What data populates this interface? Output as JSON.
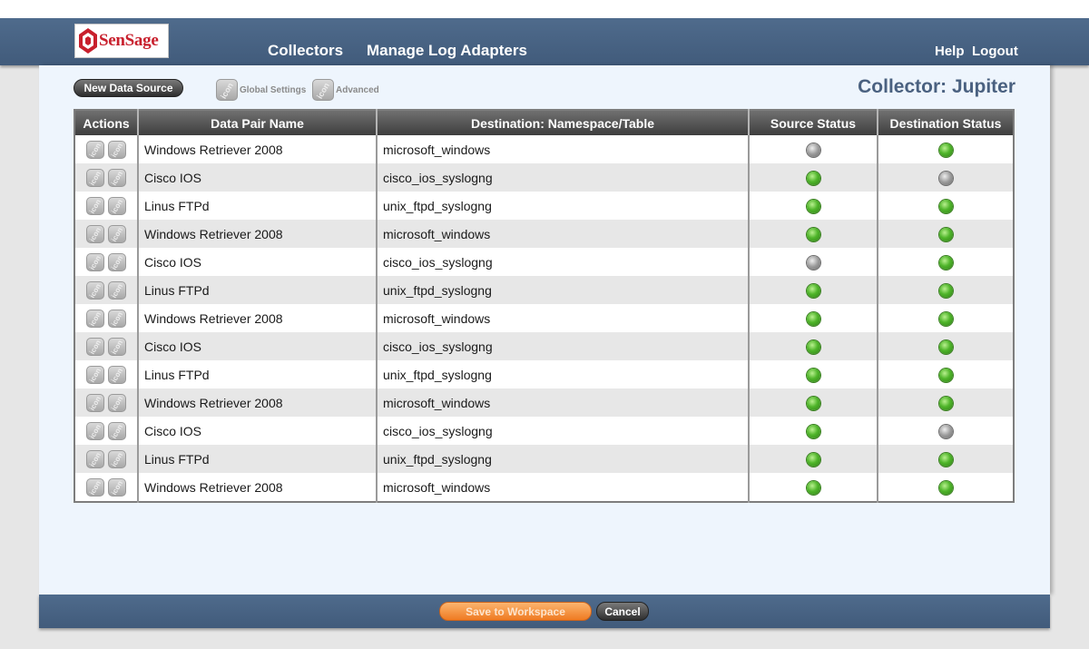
{
  "header": {
    "logo_text": "SenSage",
    "nav": [
      "Collectors",
      "Manage Log Adapters"
    ],
    "help": "Help",
    "logout": "Logout"
  },
  "toolbar": {
    "new_data_source": "New Data Source",
    "global_settings": "Global Settings",
    "advanced": "Advanced",
    "collector_title": "Collector: Jupiter"
  },
  "table": {
    "columns": [
      "Actions",
      "Data Pair Name",
      "Destination: Namespace/Table",
      "Source Status",
      "Destination Status"
    ],
    "rows": [
      {
        "name": "Windows Retriever 2008",
        "dest": "microsoft_windows",
        "source_status": "inactive",
        "dest_status": "active"
      },
      {
        "name": "Cisco IOS",
        "dest": "cisco_ios_syslogng",
        "source_status": "active",
        "dest_status": "inactive"
      },
      {
        "name": "Linus FTPd",
        "dest": "unix_ftpd_syslogng",
        "source_status": "active",
        "dest_status": "active"
      },
      {
        "name": "Windows Retriever 2008",
        "dest": "microsoft_windows",
        "source_status": "active",
        "dest_status": "active"
      },
      {
        "name": "Cisco IOS",
        "dest": "cisco_ios_syslogng",
        "source_status": "inactive",
        "dest_status": "active"
      },
      {
        "name": "Linus FTPd",
        "dest": "unix_ftpd_syslogng",
        "source_status": "active",
        "dest_status": "active"
      },
      {
        "name": "Windows Retriever 2008",
        "dest": "microsoft_windows",
        "source_status": "active",
        "dest_status": "active"
      },
      {
        "name": "Cisco IOS",
        "dest": "cisco_ios_syslogng",
        "source_status": "active",
        "dest_status": "active"
      },
      {
        "name": "Linus FTPd",
        "dest": "unix_ftpd_syslogng",
        "source_status": "active",
        "dest_status": "active"
      },
      {
        "name": "Windows Retriever 2008",
        "dest": "microsoft_windows",
        "source_status": "active",
        "dest_status": "active"
      },
      {
        "name": "Cisco IOS",
        "dest": "cisco_ios_syslogng",
        "source_status": "active",
        "dest_status": "inactive"
      },
      {
        "name": "Linus FTPd",
        "dest": "unix_ftpd_syslogng",
        "source_status": "active",
        "dest_status": "active"
      },
      {
        "name": "Windows Retriever 2008",
        "dest": "microsoft_windows",
        "source_status": "active",
        "dest_status": "active"
      }
    ]
  },
  "footer": {
    "save": "Save to Workspace",
    "cancel": "Cancel"
  },
  "colors": {
    "header_bg": "#4a6586",
    "status_active": "#4fb52a",
    "status_inactive": "#9a9a9a",
    "accent_orange": "#ef7a22"
  }
}
